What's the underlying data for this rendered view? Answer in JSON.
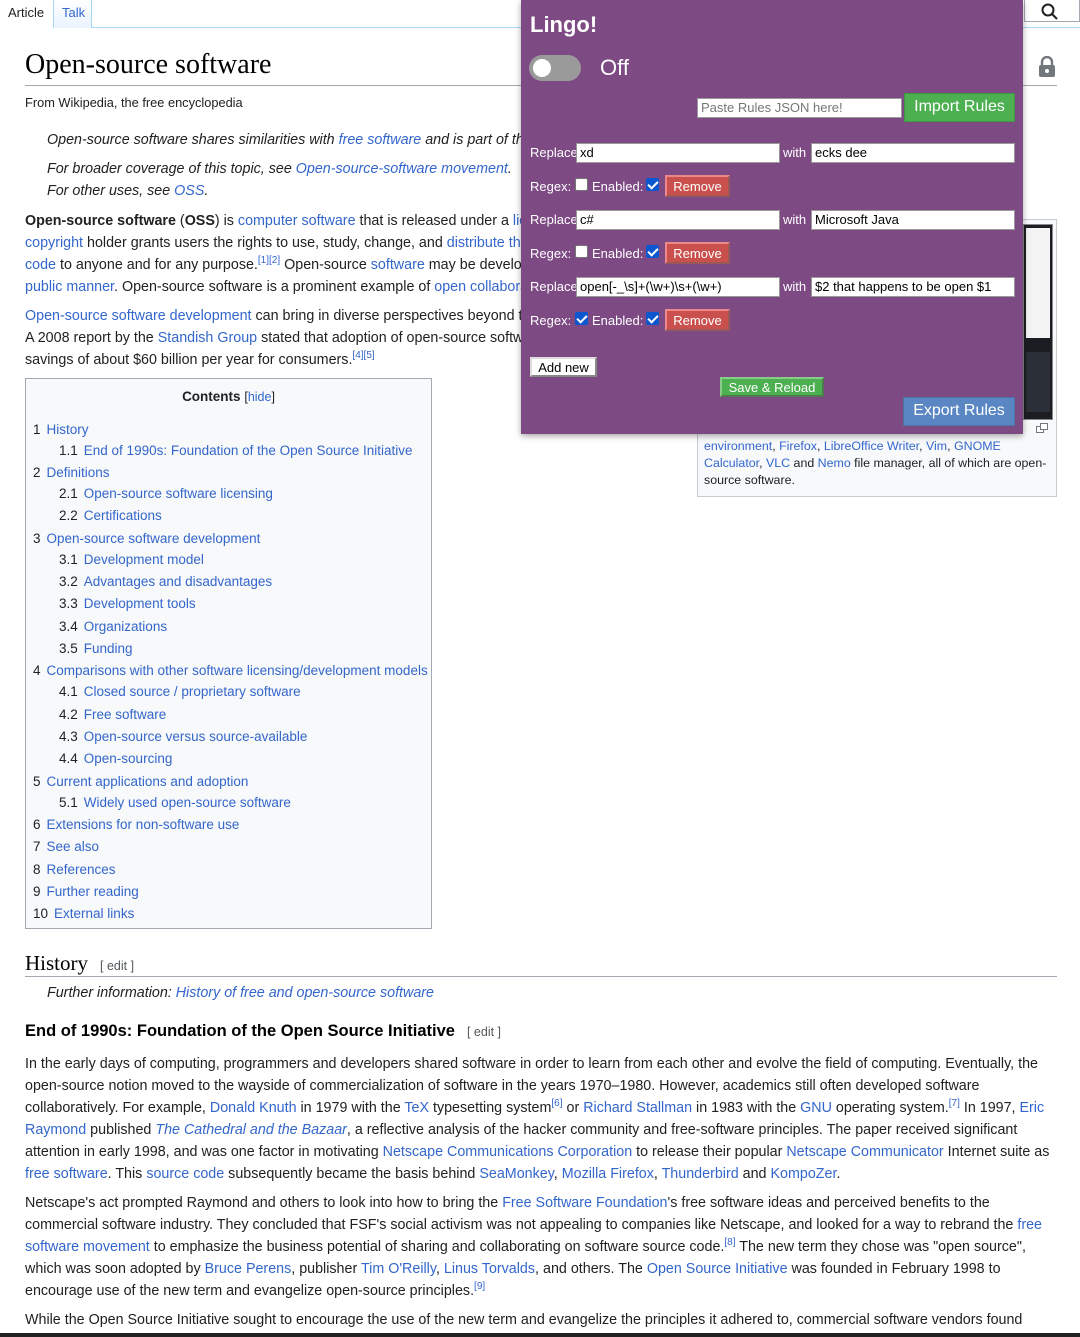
{
  "tabs": {
    "article": "Article",
    "talk": "Talk"
  },
  "article": {
    "title": "Open-source software",
    "tagline": "From Wikipedia, the free encyclopedia",
    "hatnote1_a": "Open-source software shares similarities with ",
    "hatnote1_link": "free software",
    "hatnote1_b": " and is part of the",
    "hatnote2_a": "For broader coverage of this topic, see ",
    "hatnote2_link": "Open-source-software movement",
    "hatnote2_b": ".",
    "hatnote3_a": "For other uses, see ",
    "hatnote3_link": "OSS",
    "hatnote3_b": ".",
    "intro": {
      "l1_bold": "Open-source software",
      "l1_a": " (",
      "l1_bold2": "OSS",
      "l1_b": ") is ",
      "l1_link": "computer software",
      "l1_c": " that is released under a ",
      "l1_link2": "lice",
      "l2_link": "copyright",
      "l2_a": " holder grants users the rights to use, study, change, and ",
      "l2_link2": "distribute the",
      "l3_link": "code",
      "l3_a": " to anyone and for any purpose.",
      "l3_sup": "[1][2]",
      "l3_b": " Open-source ",
      "l3_link2": "software",
      "l3_c": " may be develop",
      "l4_link": "public manner",
      "l4_a": ". Open-source software is a prominent example of ",
      "l4_link2": "open collaborat",
      "p2_l1_link": "Open-source software development",
      "p2_l1_a": " can bring in diverse perspectives beyond th",
      "p2_l2_a": "A 2008 report by the ",
      "p2_l2_link": "Standish Group",
      "p2_l2_b": " stated that adoption of open-source softwa",
      "p2_l3_a": "savings of about $60 billion per year for consumers.",
      "p2_l3_sup": "[4][5]"
    },
    "caption": {
      "c1_link": "environment",
      "c1_a": ", ",
      "c1_link2": "Firefox",
      "c1_b": ", ",
      "c1_link3": "LibreOffice Writer",
      "c1_c": ", ",
      "c1_link4": "Vim",
      "c1_d": ", ",
      "c1_link5": "GNOME",
      "c2_link": "Calculator",
      "c2_a": ", ",
      "c2_link2": "VLC",
      "c2_b": " and ",
      "c2_link3": "Nemo",
      "c2_c": " file manager, all of which are open-",
      "c3": "source software."
    },
    "toc": {
      "title": "Contents",
      "hide_open": "[",
      "hide": "hide",
      "hide_close": "]",
      "items": [
        {
          "num": "1",
          "label": "History"
        },
        {
          "num": "1.1",
          "label": "End of 1990s: Foundation of the Open Source Initiative"
        },
        {
          "num": "2",
          "label": "Definitions"
        },
        {
          "num": "2.1",
          "label": "Open-source software licensing"
        },
        {
          "num": "2.2",
          "label": "Certifications"
        },
        {
          "num": "3",
          "label": "Open-source software development"
        },
        {
          "num": "3.1",
          "label": "Development model"
        },
        {
          "num": "3.2",
          "label": "Advantages and disadvantages"
        },
        {
          "num": "3.3",
          "label": "Development tools"
        },
        {
          "num": "3.4",
          "label": "Organizations"
        },
        {
          "num": "3.5",
          "label": "Funding"
        },
        {
          "num": "4",
          "label": "Comparisons with other software licensing/development models"
        },
        {
          "num": "4.1",
          "label": "Closed source / proprietary software"
        },
        {
          "num": "4.2",
          "label": "Free software"
        },
        {
          "num": "4.3",
          "label": "Open-source versus source-available"
        },
        {
          "num": "4.4",
          "label": "Open-sourcing"
        },
        {
          "num": "5",
          "label": "Current applications and adoption"
        },
        {
          "num": "5.1",
          "label": "Widely used open-source software"
        },
        {
          "num": "6",
          "label": "Extensions for non-software use"
        },
        {
          "num": "7",
          "label": "See also"
        },
        {
          "num": "8",
          "label": "References"
        },
        {
          "num": "9",
          "label": "Further reading"
        },
        {
          "num": "10",
          "label": "External links"
        }
      ]
    },
    "history": {
      "heading": "History",
      "edit": "[ edit ]",
      "further_a": "Further information: ",
      "further_link": "History of free and open-source software",
      "sub_heading": "End of 1990s: Foundation of the Open Source Initiative",
      "sub_edit": "[ edit ]",
      "p1": {
        "t1": "In the early days of computing, programmers and developers shared software in order to learn from each other and evolve the field of computing. Eventually, the open-source notion moved to the wayside of commercialization of software in the years 1970–1980. However, academics still often developed software collaboratively. For example, ",
        "link1": "Donald Knuth",
        "t2": " in 1979 with the ",
        "link2": "TeX",
        "t3": " typesetting system",
        "sup1": "[6]",
        "t4": " or ",
        "link3": "Richard Stallman",
        "t5": " in 1983 with the ",
        "link4": "GNU",
        "t6": " operating system.",
        "sup2": "[7]",
        "t7": " In 1997, ",
        "link5": "Eric Raymond",
        "t8": " published ",
        "link6": "The Cathedral and the Bazaar",
        "t9": ", a reflective analysis of the hacker community and free-software principles. The paper received significant attention in early 1998, and was one factor in motivating ",
        "link7": "Netscape Communications Corporation",
        "t10": " to release their popular ",
        "link8": "Netscape Communicator",
        "t11": " Internet suite as ",
        "link9": "free software",
        "t12": ". This ",
        "link10": "source code",
        "t13": " subsequently became the basis behind ",
        "link11": "SeaMonkey",
        "t14": ", ",
        "link12": "Mozilla Firefox",
        "t15": ", ",
        "link13": "Thunderbird",
        "t16": " and ",
        "link14": "KompoZer",
        "t17": "."
      },
      "p2": {
        "t1": "Netscape's act prompted Raymond and others to look into how to bring the ",
        "link1": "Free Software Foundation",
        "t2": "'s free software ideas and perceived benefits to the commercial software industry. They concluded that FSF's social activism was not appealing to companies like Netscape, and looked for a way to rebrand the ",
        "link2": "free software movement",
        "t3": " to emphasize the business potential of sharing and collaborating on software source code.",
        "sup1": "[8]",
        "t4": " The new term they chose was \"open source\", which was soon adopted by ",
        "link3": "Bruce Perens",
        "t5": ", publisher ",
        "link4": "Tim O'Reilly",
        "t6": ", ",
        "link5": "Linus Torvalds",
        "t7": ", and others. The ",
        "link6": "Open Source Initiative",
        "t8": " was founded in February 1998 to encourage use of the new term and evangelize open-source principles.",
        "sup2": "[9]"
      },
      "p3": "While the Open Source Initiative sought to encourage the use of the new term and evangelize the principles it adhered to, commercial software vendors found"
    }
  },
  "lingo": {
    "title": "Lingo!",
    "state": "Off",
    "enabled": false,
    "json_placeholder": "Paste Rules JSON here!",
    "import_label": "Import Rules",
    "replace_label": "Replace",
    "with_label": "with",
    "regex_label": "Regex:",
    "enabled_label": "Enabled:",
    "remove_label": "Remove",
    "rules": [
      {
        "find": "xd",
        "replace": "ecks dee",
        "regex": false,
        "enabled": true
      },
      {
        "find": "c#",
        "replace": "Microsoft Java",
        "regex": false,
        "enabled": true
      },
      {
        "find": "open[-_\\s]+(\\w+)\\s+(\\w+)",
        "replace": "$2 that happens to be open $1",
        "regex": true,
        "enabled": true
      }
    ],
    "add_new_label": "Add new",
    "save_label": "Save & Reload",
    "export_label": "Export Rules",
    "colors": {
      "background": "#7d4a84",
      "import": "#4caf50",
      "export": "#5a87c4",
      "remove": "#c9504c"
    }
  }
}
